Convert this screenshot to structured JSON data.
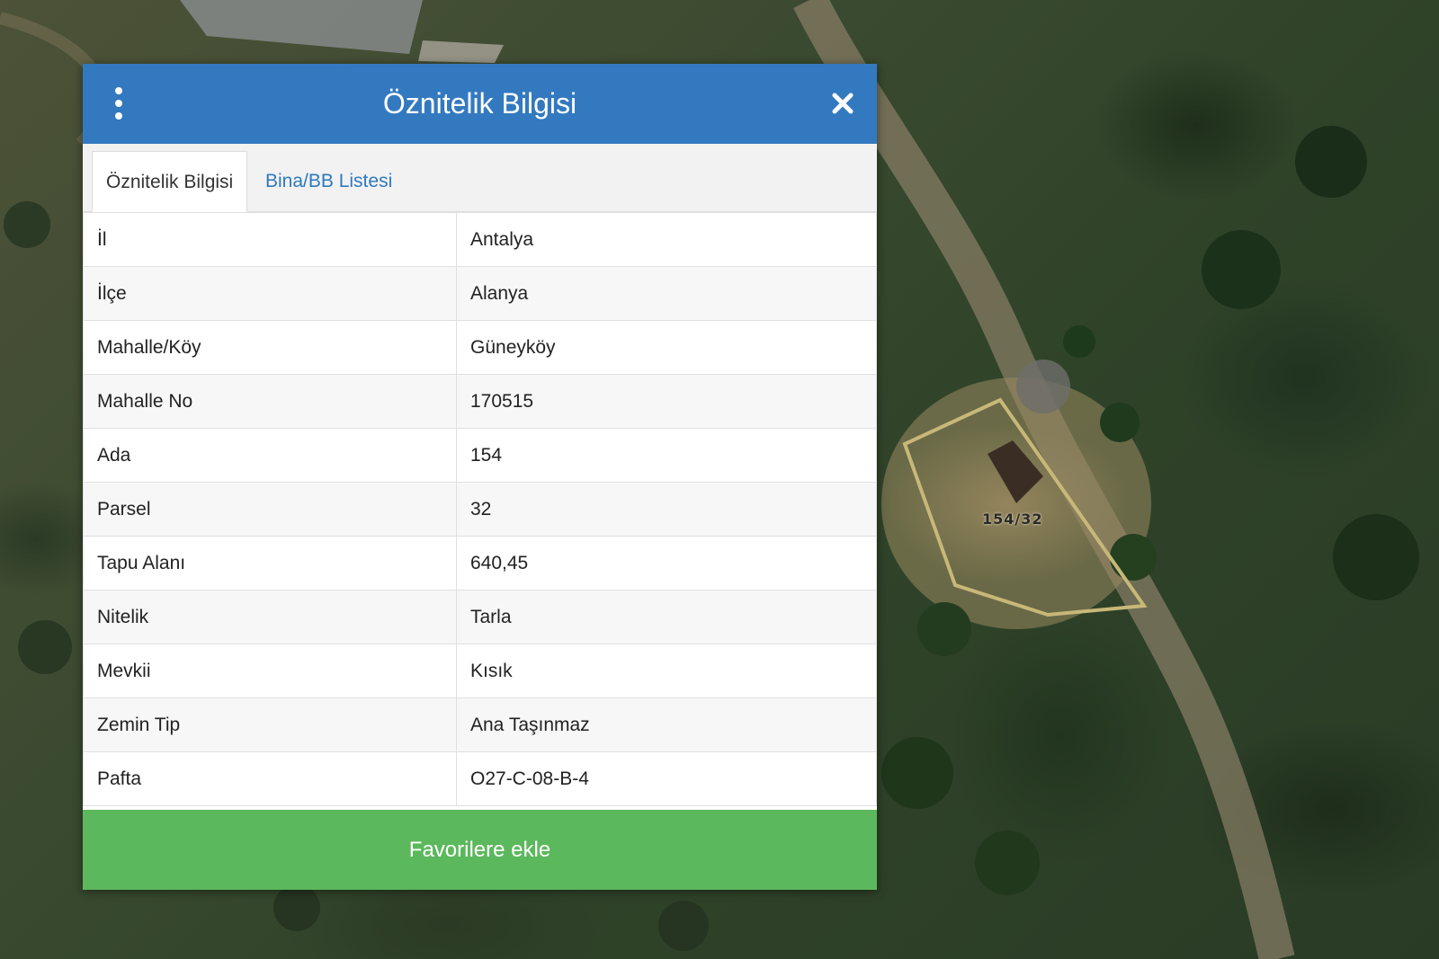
{
  "map": {
    "parcel_label": "154/32"
  },
  "panel": {
    "title": "Öznitelik Bilgisi",
    "menu_icon": "vertical-dots-icon",
    "close_icon": "close-icon",
    "tabs": [
      {
        "label": "Öznitelik Bilgisi",
        "active": true
      },
      {
        "label": "Bina/BB Listesi",
        "active": false
      }
    ],
    "rows": [
      {
        "key": "İl",
        "value": "Antalya"
      },
      {
        "key": "İlçe",
        "value": "Alanya"
      },
      {
        "key": "Mahalle/Köy",
        "value": "Güneyköy"
      },
      {
        "key": "Mahalle No",
        "value": "170515"
      },
      {
        "key": "Ada",
        "value": "154"
      },
      {
        "key": "Parsel",
        "value": "32"
      },
      {
        "key": "Tapu Alanı",
        "value": "640,45"
      },
      {
        "key": "Nitelik",
        "value": "Tarla"
      },
      {
        "key": "Mevkii",
        "value": "Kısık"
      },
      {
        "key": "Zemin Tip",
        "value": "Ana Taşınmaz"
      },
      {
        "key": "Pafta",
        "value": "O27-C-08-B-4"
      }
    ],
    "favorite_button": "Favorilere ekle"
  },
  "colors": {
    "header": "#3379bf",
    "tab_link": "#2f79be",
    "button": "#5cb85c",
    "parcel_outline": "#c8b878"
  }
}
